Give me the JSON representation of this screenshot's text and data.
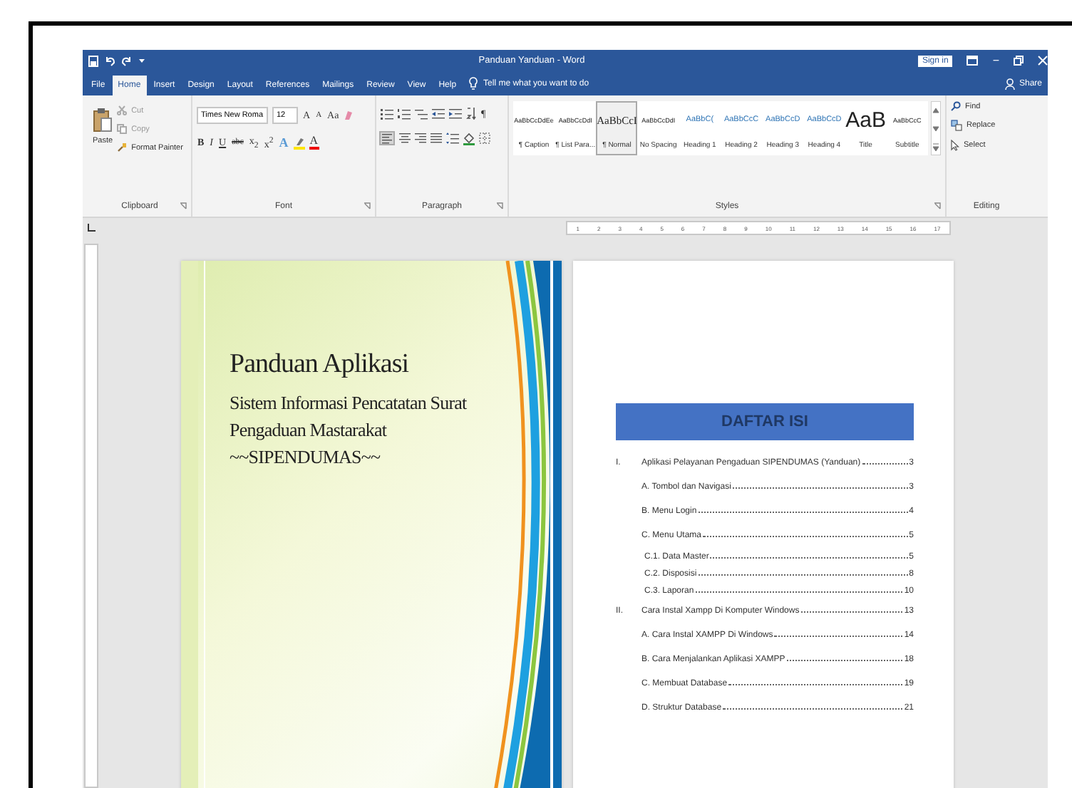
{
  "window": {
    "title": "Panduan Yanduan - Word",
    "sign_in": "Sign in",
    "minimize": "−"
  },
  "tabs": [
    {
      "label": "File",
      "selected": false
    },
    {
      "label": "Home",
      "selected": true
    },
    {
      "label": "Insert",
      "selected": false
    },
    {
      "label": "Design",
      "selected": false
    },
    {
      "label": "Layout",
      "selected": false
    },
    {
      "label": "References",
      "selected": false
    },
    {
      "label": "Mailings",
      "selected": false
    },
    {
      "label": "Review",
      "selected": false
    },
    {
      "label": "View",
      "selected": false
    },
    {
      "label": "Help",
      "selected": false
    }
  ],
  "tell_me": "Tell me what you want to do",
  "share": "Share",
  "clipboard": {
    "paste": "Paste",
    "cut": "Cut",
    "copy": "Copy",
    "format_painter": "Format Painter",
    "label": "Clipboard"
  },
  "font": {
    "name": "Times New Roma",
    "size": "12",
    "grow": "A",
    "shrink": "A",
    "change_case": "Aa",
    "format_buttons": [
      "B",
      "I",
      "U",
      "abc",
      "x$_{2}$",
      "x$^{2}$"
    ],
    "text_effects": "A",
    "font_color": "A",
    "label": "Font"
  },
  "paragraph": {
    "pilcrow": "¶",
    "label": "Paragraph"
  },
  "styles": {
    "label": "Styles",
    "items": [
      {
        "sample": "AaBbCcDdEe",
        "name": "¶ Caption",
        "kind": "body",
        "selected": false
      },
      {
        "sample": "AaBbCcDdI",
        "name": "¶ List Para...",
        "kind": "body",
        "selected": false
      },
      {
        "sample": "AaBbCcI",
        "name": "¶ Normal",
        "kind": "normal",
        "selected": true
      },
      {
        "sample": "AaBbCcDdI",
        "name": "No Spacing",
        "kind": "body",
        "selected": false
      },
      {
        "sample": "AaBbC(",
        "name": "Heading 1",
        "kind": "heading",
        "selected": false
      },
      {
        "sample": "AaBbCcC",
        "name": "Heading 2",
        "kind": "heading",
        "selected": false
      },
      {
        "sample": "AaBbCcD",
        "name": "Heading 3",
        "kind": "heading",
        "selected": false
      },
      {
        "sample": "AaBbCcD",
        "name": "Heading 4",
        "kind": "heading",
        "selected": false
      },
      {
        "sample": "AaB",
        "name": "Title",
        "kind": "title",
        "selected": false
      },
      {
        "sample": "AaBbCcC",
        "name": "Subtitle",
        "kind": "body",
        "selected": false
      }
    ]
  },
  "editing": {
    "find": "Find",
    "replace": "Replace",
    "select": "Select",
    "label": "Editing"
  },
  "ruler": {
    "numbers": [
      "1",
      "2",
      "3",
      "4",
      "5",
      "6",
      "7",
      "8",
      "9",
      "10",
      "11",
      "12",
      "13",
      "14",
      "15",
      "16",
      "17"
    ]
  },
  "cover": {
    "title": "Panduan Aplikasi",
    "subtitle_lines": [
      "Sistem Informasi Pencatatan Surat",
      "Pengaduan Mastarakat",
      "~~SIPENDUMAS~~"
    ]
  },
  "toc": {
    "heading": "DAFTAR ISI",
    "entries": [
      {
        "numeral": "I.",
        "text": "Aplikasi Pelayanan Pengaduan SIPENDUMAS (Yanduan)",
        "page": "3",
        "children": [
          {
            "text": "A. Tombol dan Navigasi",
            "page": "3"
          },
          {
            "text": "B. Menu Login",
            "page": "4"
          },
          {
            "text": "C. Menu Utama",
            "page": "5",
            "children": [
              {
                "text": "C.1. Data Master",
                "page": "5"
              },
              {
                "text": "C.2. Disposisi",
                "page": "8"
              },
              {
                "text": "C.3. Laporan",
                "page": "10"
              }
            ]
          }
        ]
      },
      {
        "numeral": "II.",
        "text": "Cara Instal Xampp Di Komputer Windows",
        "page": "13",
        "children": [
          {
            "text": "A. Cara Instal XAMPP Di Windows",
            "page": "14"
          },
          {
            "text": "B. Cara Menjalankan Aplikasi XAMPP",
            "page": "18"
          },
          {
            "text": "C. Membuat Database",
            "page": "19"
          },
          {
            "text": "D. Struktur Database",
            "page": "21"
          }
        ]
      }
    ]
  }
}
